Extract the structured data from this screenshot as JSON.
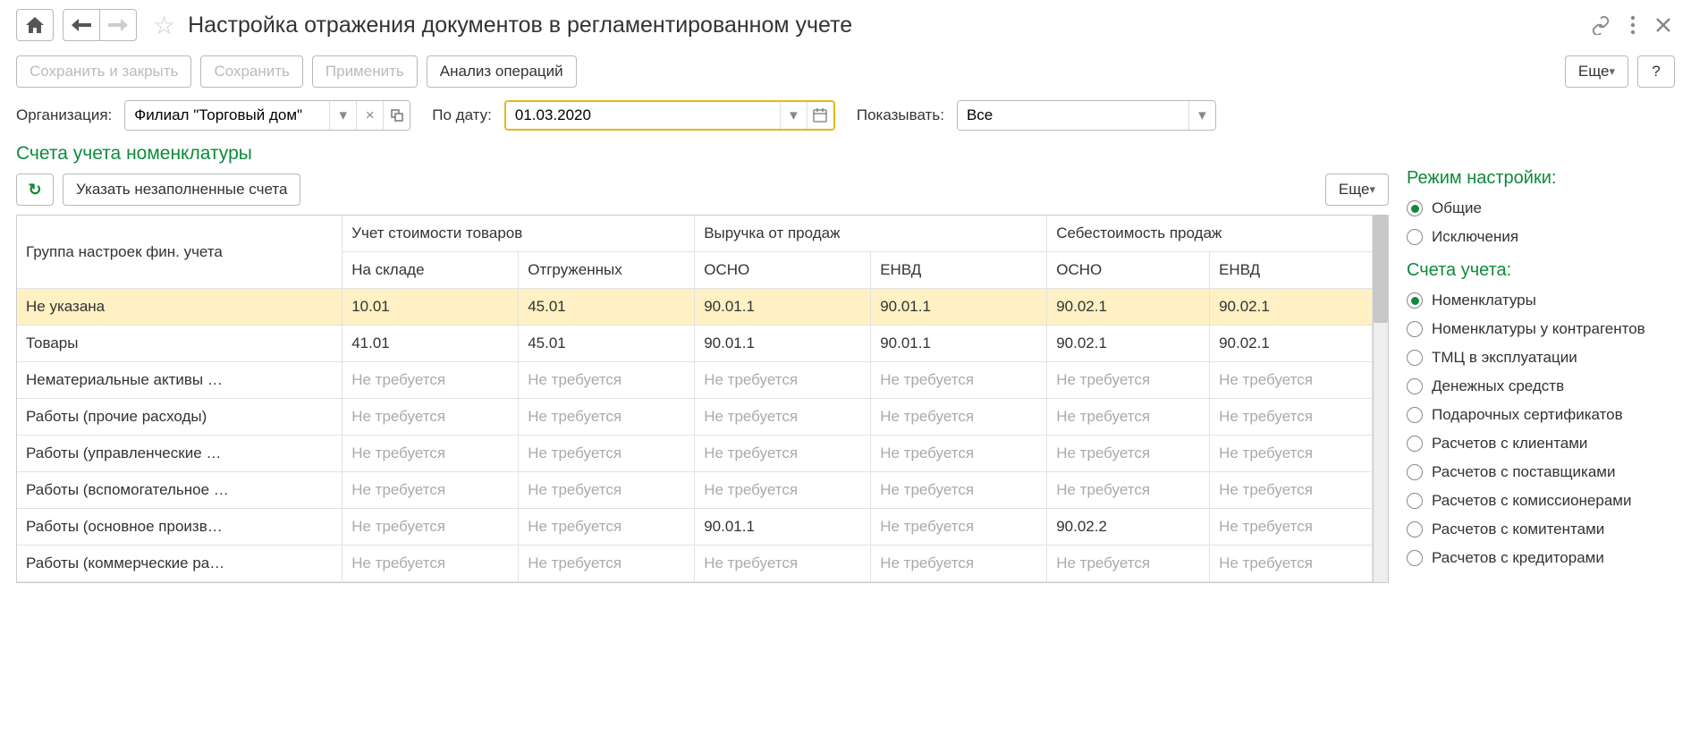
{
  "header": {
    "title": "Настройка отражения документов в регламентированном учете"
  },
  "toolbar": {
    "save_close": "Сохранить и закрыть",
    "save": "Сохранить",
    "apply": "Применить",
    "analyze": "Анализ операций",
    "more": "Еще",
    "help": "?"
  },
  "filters": {
    "org_label": "Организация:",
    "org_value": "Филиал \"Торговый дом\"",
    "date_label": "По дату:",
    "date_value": "01.03.2020",
    "show_label": "Показывать:",
    "show_value": "Все"
  },
  "section_title": "Счета учета номенклатуры",
  "table_toolbar": {
    "fill_blank": "Указать незаполненные счета",
    "more": "Еще"
  },
  "table": {
    "group_header": "Группа настроек фин. учета",
    "col_group_1": "Учет стоимости товаров",
    "col_group_2": "Выручка от продаж",
    "col_group_3": "Себестоимость продаж",
    "sub": {
      "warehouse": "На складе",
      "shipped": "Отгруженных",
      "osno1": "ОСНО",
      "envd1": "ЕНВД",
      "osno2": "ОСНО",
      "envd2": "ЕНВД"
    },
    "rows": [
      {
        "name": "Не указана",
        "highlight": true,
        "cells": [
          "10.01",
          "45.01",
          "90.01.1",
          "90.01.1",
          "90.02.1",
          "90.02.1"
        ]
      },
      {
        "name": "Товары",
        "cells": [
          "41.01",
          "45.01",
          "90.01.1",
          "90.01.1",
          "90.02.1",
          "90.02.1"
        ]
      },
      {
        "name": "Нематериальные активы …",
        "cells": [
          "Не требуется",
          "Не требуется",
          "Не требуется",
          "Не требуется",
          "Не требуется",
          "Не требуется"
        ],
        "muted": true
      },
      {
        "name": "Работы (прочие расходы)",
        "cells": [
          "Не требуется",
          "Не требуется",
          "Не требуется",
          "Не требуется",
          "Не требуется",
          "Не требуется"
        ],
        "muted": true
      },
      {
        "name": "Работы (управленческие …",
        "cells": [
          "Не требуется",
          "Не требуется",
          "Не требуется",
          "Не требуется",
          "Не требуется",
          "Не требуется"
        ],
        "muted": true
      },
      {
        "name": "Работы (вспомогательное …",
        "cells": [
          "Не требуется",
          "Не требуется",
          "Не требуется",
          "Не требуется",
          "Не требуется",
          "Не требуется"
        ],
        "muted": true
      },
      {
        "name": "Работы (основное произв…",
        "cells": [
          "Не требуется",
          "Не требуется",
          "90.01.1",
          "Не требуется",
          "90.02.2",
          "Не требуется"
        ],
        "muted_pattern": [
          true,
          true,
          false,
          true,
          false,
          true
        ]
      },
      {
        "name": "Работы (коммерческие ра…",
        "cells": [
          "Не требуется",
          "Не требуется",
          "Не требуется",
          "Не требуется",
          "Не требуется",
          "Не требуется"
        ],
        "muted": true
      }
    ]
  },
  "side": {
    "mode_heading": "Режим настройки:",
    "mode_options": [
      {
        "label": "Общие",
        "checked": true
      },
      {
        "label": "Исключения",
        "checked": false
      }
    ],
    "accounts_heading": "Счета учета:",
    "accounts_options": [
      {
        "label": "Номенклатуры",
        "checked": true
      },
      {
        "label": "Номенклатуры у контрагентов",
        "checked": false
      },
      {
        "label": "ТМЦ в эксплуатации",
        "checked": false
      },
      {
        "label": "Денежных средств",
        "checked": false
      },
      {
        "label": "Подарочных сертификатов",
        "checked": false
      },
      {
        "label": "Расчетов с клиентами",
        "checked": false
      },
      {
        "label": "Расчетов с поставщиками",
        "checked": false
      },
      {
        "label": "Расчетов с комиссионерами",
        "checked": false
      },
      {
        "label": "Расчетов с комитентами",
        "checked": false
      },
      {
        "label": "Расчетов с кредиторами",
        "checked": false
      }
    ]
  }
}
